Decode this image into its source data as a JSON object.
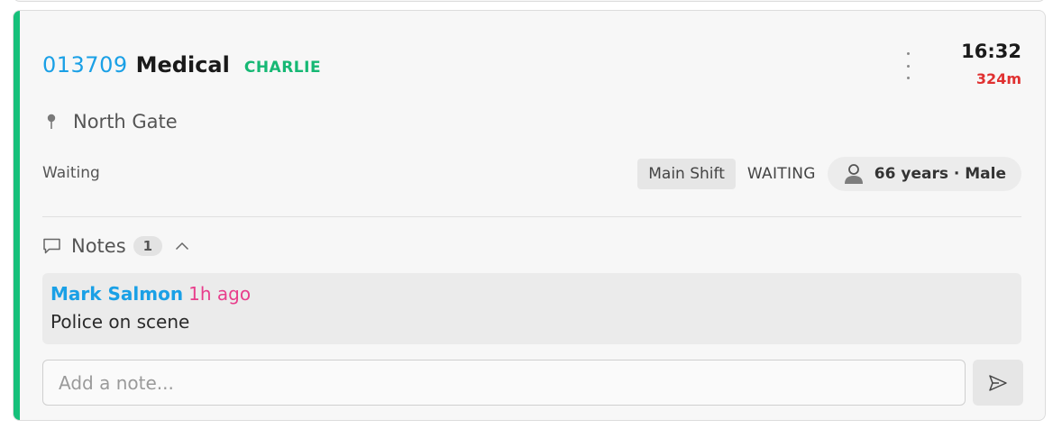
{
  "incident": {
    "id": "013709",
    "type": "Medical",
    "code": "CHARLIE",
    "time": "16:32",
    "elapsed": "324m",
    "location": "North Gate",
    "status": "Waiting",
    "shift": "Main Shift",
    "state": "WAITING",
    "patient": "66 years · Male"
  },
  "notes": {
    "label": "Notes",
    "count": "1",
    "items": [
      {
        "author": "Mark Salmon",
        "time": "1h ago",
        "text": "Police on scene"
      }
    ],
    "input_placeholder": "Add a note..."
  },
  "colors": {
    "accent": "#16c07a",
    "id": "#1aa0e6",
    "code": "#16b874",
    "elapsed": "#e03131",
    "note_time": "#e83e8c"
  },
  "icons": {
    "more": "more-vertical-icon",
    "pin": "map-pin-icon",
    "person": "person-icon",
    "comment": "comment-icon",
    "collapse": "chevron-up-icon",
    "send": "send-icon"
  }
}
